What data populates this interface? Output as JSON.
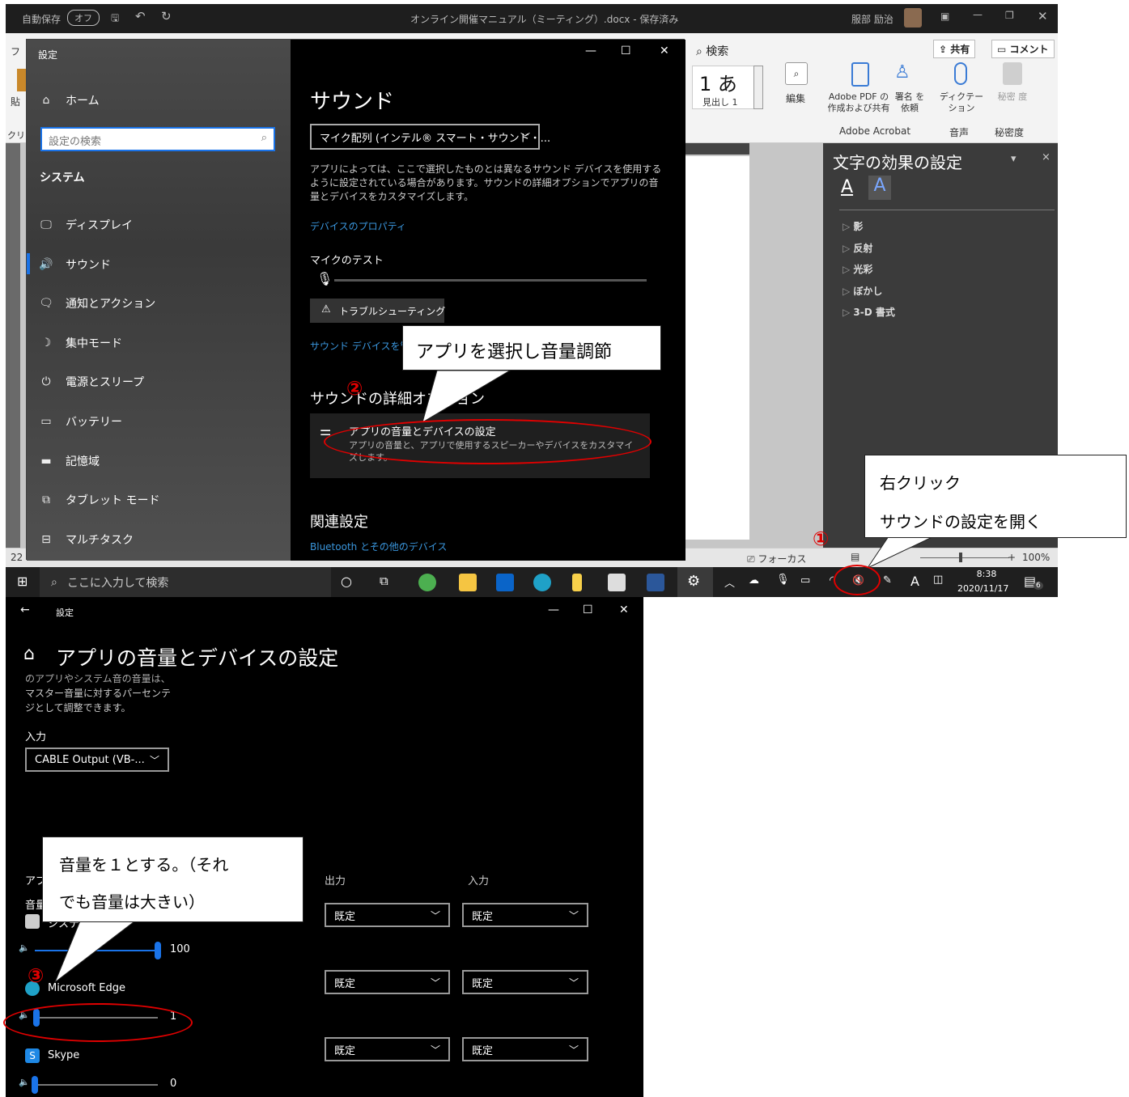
{
  "word": {
    "autosave_label": "自動保存",
    "autosave_state": "オフ",
    "doc_title": "オンライン開催マニュアル（ミーティング）.docx - 保存済み",
    "user_name": "服部 励治",
    "search_label": "検索",
    "share_label": "共有",
    "comment_label": "コメント",
    "style_preview": "1 あ",
    "style_name": "見出し 1",
    "edit_label": "編集",
    "adobe_pdf_label": "Adobe PDF の 作成および共有",
    "sign_label": "署名 を依頼",
    "dictate_label": "ディクテー ション",
    "sensitivity_label": "秘密 度",
    "group_adobe": "Adobe Acrobat",
    "group_voice": "音声",
    "group_sensitivity": "秘密度",
    "left_fragment_1": "フ",
    "left_fragment_2": "貼",
    "left_fragment_3": "クリ",
    "pane_title": "文字の効果の設定",
    "pane_items": [
      "影",
      "反射",
      "光彩",
      "ぼかし",
      "3-D 書式"
    ],
    "status_focus": "フォーカス",
    "status_zoom": "100%",
    "status_left": "22"
  },
  "settings1": {
    "title": "設定",
    "home": "ホーム",
    "search_placeholder": "設定の検索",
    "section": "システム",
    "nav": [
      {
        "icon": "display-icon",
        "label": "ディスプレイ"
      },
      {
        "icon": "sound-icon",
        "label": "サウンド"
      },
      {
        "icon": "notification-icon",
        "label": "通知とアクション"
      },
      {
        "icon": "focus-icon",
        "label": "集中モード"
      },
      {
        "icon": "power-icon",
        "label": "電源とスリープ"
      },
      {
        "icon": "battery-icon",
        "label": "バッテリー"
      },
      {
        "icon": "storage-icon",
        "label": "記憶域"
      },
      {
        "icon": "tablet-icon",
        "label": "タブレット モード"
      },
      {
        "icon": "multitask-icon",
        "label": "マルチタスク"
      }
    ],
    "page_title": "サウンド",
    "device_select": "マイク配列 (インテル® スマート・サウンド・...",
    "description": "アプリによっては、ここで選択したものとは異なるサウンド デバイスを使用するように設定されている場合があります。サウンドの詳細オプションでアプリの音量とデバイスをカスタマイズします。",
    "device_properties_link": "デバイスのプロパティ",
    "mic_test_label": "マイクのテスト",
    "troubleshoot_button": "トラブルシューティング",
    "manage_link": "サウンド デバイスを管",
    "advanced_heading": "サウンドの詳細オプション",
    "app_volume_title": "アプリの音量とデバイスの設定",
    "app_volume_desc": "アプリの音量と、アプリで使用するスピーカーやデバイスをカスタマイズします。",
    "related_heading": "関連設定",
    "bluetooth_link": "Bluetooth とその他のデバイス"
  },
  "taskbar": {
    "search_placeholder": "ここに入力して検索",
    "time": "8:38",
    "date": "2020/11/17",
    "notification_count": "6",
    "ime_label": "A"
  },
  "settings2": {
    "back_label": "←",
    "window_title": "設定",
    "page_title": "アプリの音量とデバイスの設定",
    "desc_partial": "のアプリやシステム音の音量は、",
    "desc_line2": "マスター音量に対するパーセンテ",
    "desc_line3": "ジとして調整できます。",
    "input_label": "入力",
    "input_select": "CABLE Output (VB-...",
    "col_app_partial": "アプ",
    "col_volume_partial": "音量",
    "col_output": "出力",
    "col_input": "入力",
    "apps": [
      {
        "name": "システム",
        "volume": 100,
        "volume_text": "100",
        "output": "既定",
        "input": "既定"
      },
      {
        "name": "Microsoft Edge",
        "volume": 1,
        "volume_text": "1",
        "output": "既定",
        "input": "既定"
      },
      {
        "name": "Skype",
        "volume": 0,
        "volume_text": "0",
        "output": "既定",
        "input": "既定"
      }
    ]
  },
  "callouts": {
    "select_app": "アプリを選択し音量調節",
    "right_click_line1": "右クリック",
    "right_click_line2": "サウンドの設定を開く",
    "volume_line1": "音量を１とする。（それ",
    "volume_line2": "でも音量は大きい）",
    "step1": "①",
    "step2": "②",
    "step3": "③"
  },
  "colors": {
    "accent": "#1a73e8",
    "link": "#3a96dd",
    "annotation_red": "#e00000"
  }
}
